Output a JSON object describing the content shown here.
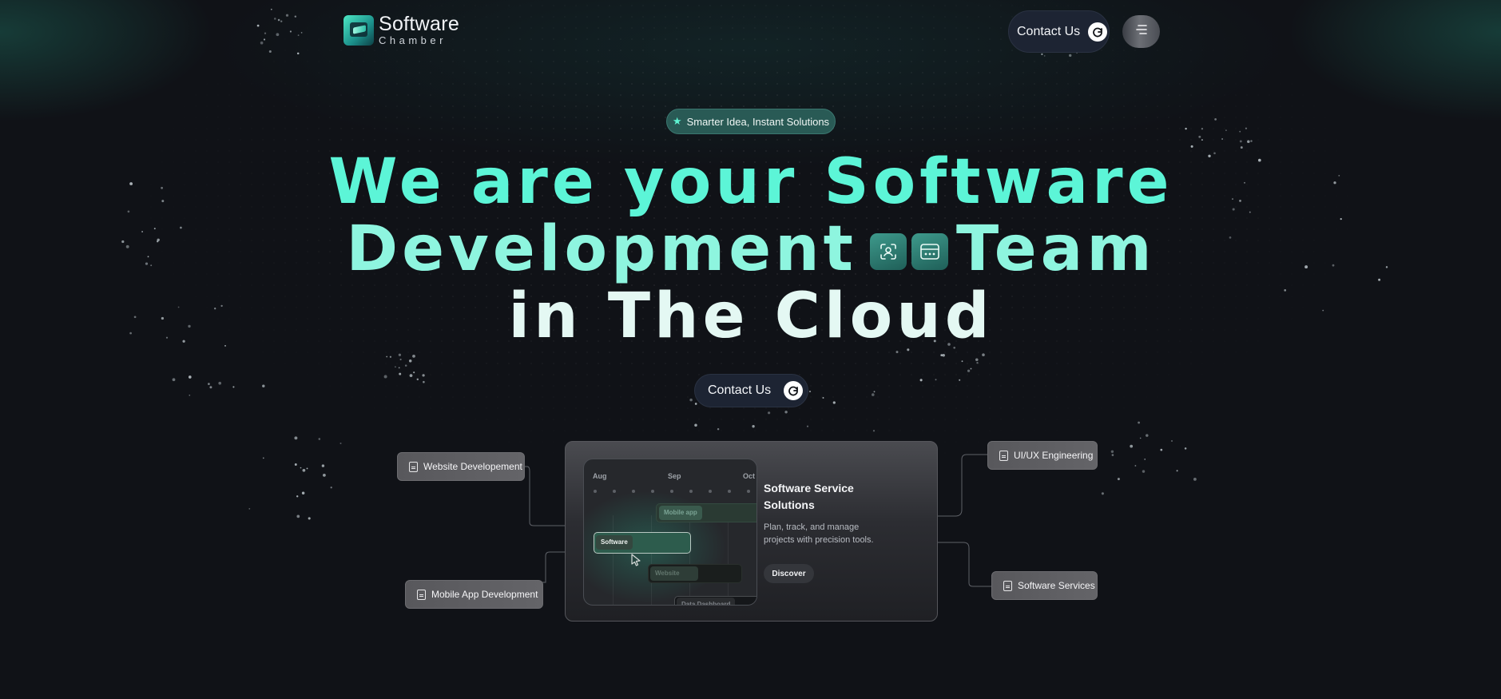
{
  "brand": {
    "name_line1": "Software",
    "name_line2": "Chamber"
  },
  "header": {
    "contact_label": "Contact Us",
    "menu_icon": "hamburger-icon"
  },
  "badge": {
    "label": "Smarter Idea, Instant Solutions",
    "icon": "star-icon"
  },
  "hero": {
    "line1": "We are your Software",
    "line2_start": "Development",
    "line2_end": "Team",
    "line3": "in The Cloud",
    "inline_icons": [
      "face-scan-icon",
      "browser-window-icon"
    ]
  },
  "cta": {
    "contact_label": "Contact Us"
  },
  "card": {
    "title": "Software Service Solutions",
    "description": "Plan, track, and manage projects with precision tools.",
    "button_label": "Discover",
    "timeline": {
      "months": [
        "Aug",
        "Sep",
        "Oct"
      ],
      "bars": [
        "Mobile app",
        "Software",
        "Website",
        "Data Dashboard"
      ]
    }
  },
  "services": {
    "website": "Website Developement",
    "mobile": "Mobile App Development",
    "uiux": "UI/UX Engineering",
    "software": "Software Services"
  },
  "colors": {
    "background": "#101217",
    "accent": "#5cf5d7",
    "accent_light": "#8ef5df",
    "button_bg": "#1d2433",
    "badge_bg": "#295a55"
  }
}
